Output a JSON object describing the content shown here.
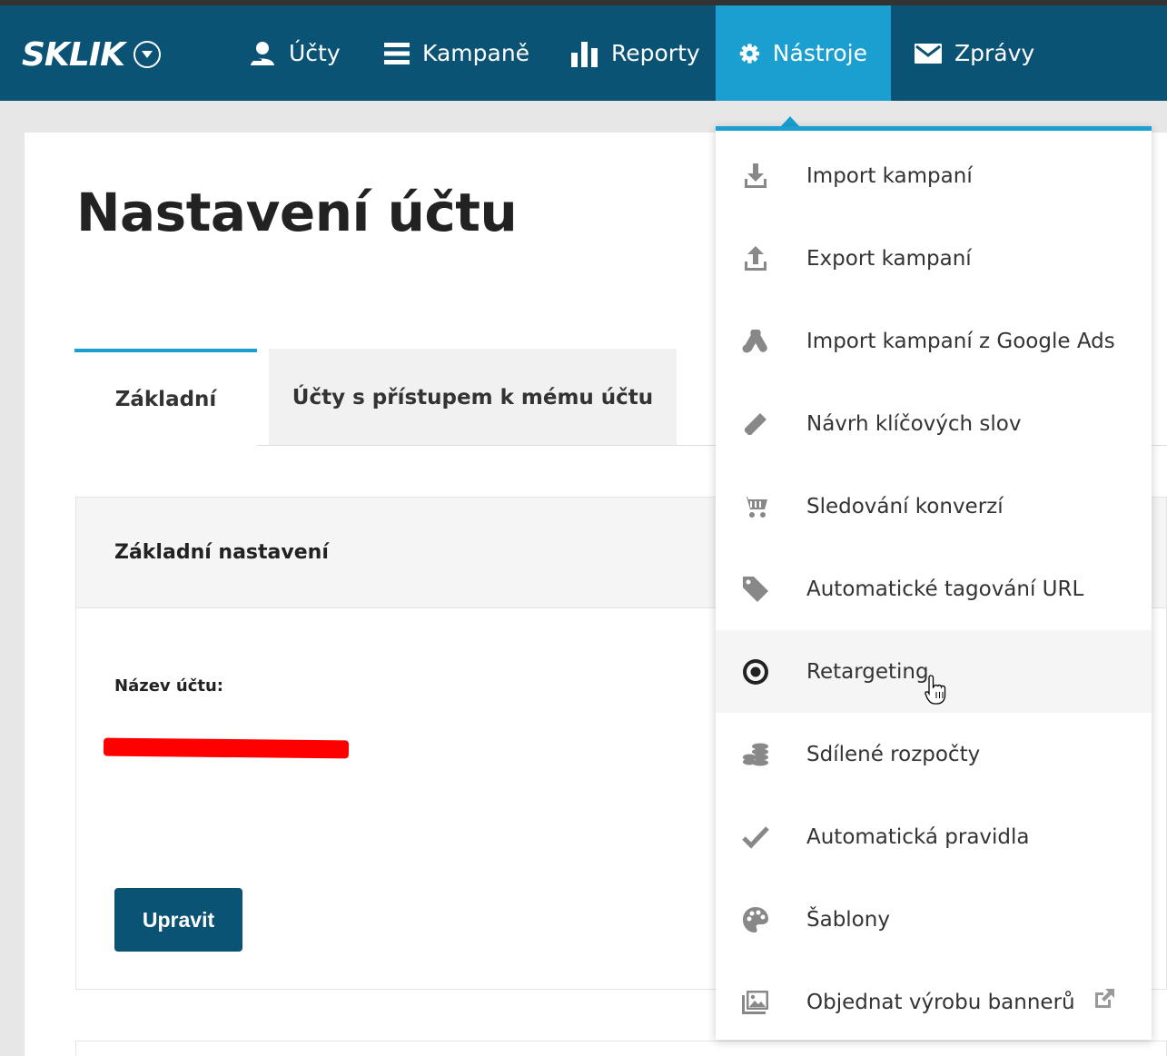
{
  "nav": {
    "logo": "SKLIK",
    "items": [
      {
        "label": "Účty",
        "icon": "user-icon"
      },
      {
        "label": "Kampaně",
        "icon": "list-icon"
      },
      {
        "label": "Reporty",
        "icon": "bar-chart-icon"
      },
      {
        "label": "Nástroje",
        "icon": "gear-icon",
        "active": true
      },
      {
        "label": "Zprávy",
        "icon": "envelope-icon"
      }
    ]
  },
  "page": {
    "title": "Nastavení účtu",
    "tabs": [
      "Základní",
      "Účty s přístupem k mému účtu"
    ],
    "section_title": "Základní nastavení",
    "field_label": "Název účtu:",
    "edit_button": "Upravit"
  },
  "dropdown": {
    "items": [
      {
        "label": "Import kampaní",
        "icon": "download-icon"
      },
      {
        "label": "Export kampaní",
        "icon": "upload-icon"
      },
      {
        "label": "Import kampaní z Google Ads",
        "icon": "google-ads-icon"
      },
      {
        "label": "Návrh klíčových slov",
        "icon": "pencil-icon"
      },
      {
        "label": "Sledování konverzí",
        "icon": "cart-icon"
      },
      {
        "label": "Automatické tagování URL",
        "icon": "tag-icon"
      },
      {
        "label": "Retargeting",
        "icon": "target-icon",
        "hovered": true
      },
      {
        "label": "Sdílené rozpočty",
        "icon": "coins-icon"
      },
      {
        "label": "Automatická pravidla",
        "icon": "check-icon"
      },
      {
        "label": "Šablony",
        "icon": "palette-icon"
      },
      {
        "label": "Objednat výrobu bannerů",
        "icon": "image-icon",
        "external": true
      }
    ]
  },
  "colors": {
    "navbar": "#0b5374",
    "accent": "#1a9fd0",
    "button": "#0b5374"
  }
}
